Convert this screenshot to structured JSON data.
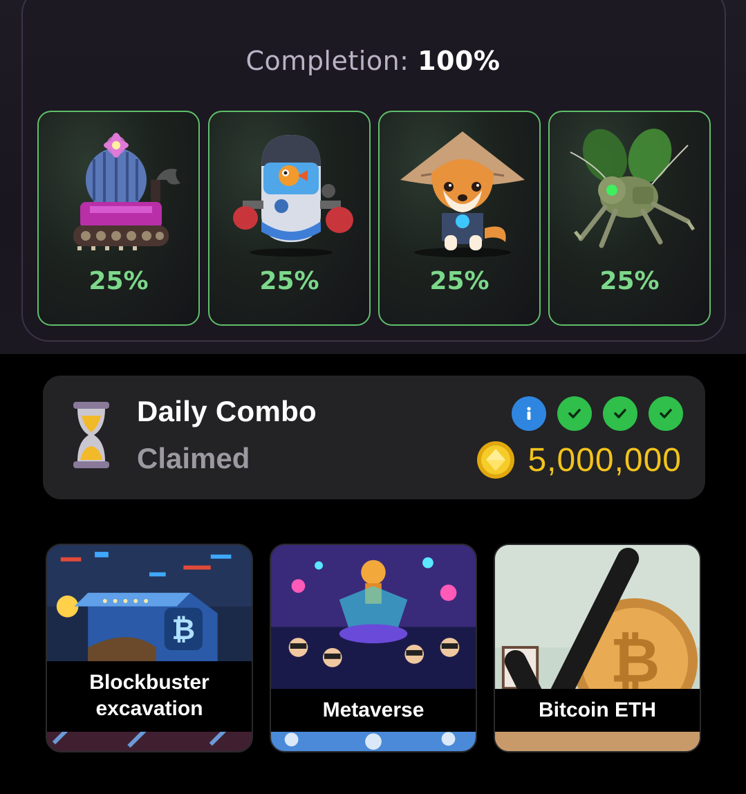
{
  "progress": {
    "label": "Completion:",
    "value": "100%",
    "fraction": 1.0,
    "cards": [
      {
        "name": "cactus-tank",
        "percent": "25%",
        "icon": "cactus-tank-icon"
      },
      {
        "name": "fish-robot",
        "percent": "25%",
        "icon": "fish-robot-icon"
      },
      {
        "name": "shiba-hat",
        "percent": "25%",
        "icon": "shiba-dog-icon"
      },
      {
        "name": "bug-mech",
        "percent": "25%",
        "icon": "bug-mech-icon"
      }
    ]
  },
  "daily_combo": {
    "title": "Daily Combo",
    "status": "Claimed",
    "reward": "5,000,000",
    "icons": [
      "hourglass-icon",
      "info-icon",
      "check-icon",
      "check-icon",
      "check-icon",
      "coin-icon"
    ],
    "colors": {
      "info": "#2f86e0",
      "check": "#2fbf4a",
      "reward": "#f2c31c"
    }
  },
  "tiles": [
    {
      "label": "Blockbuster excavation",
      "line1": "Blockbuster",
      "line2": "excavation"
    },
    {
      "label": "Metaverse"
    },
    {
      "label": "Bitcoin ETH"
    }
  ],
  "colors": {
    "accent_green": "#7cd88a",
    "card_border": "#5fbf6b",
    "background": "#000000"
  }
}
